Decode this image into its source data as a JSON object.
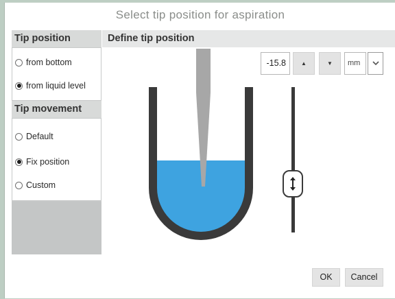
{
  "dialog": {
    "title": "Select tip position for aspiration"
  },
  "tip_position": {
    "heading": "Tip position",
    "options": [
      {
        "label": "from bottom",
        "selected": false
      },
      {
        "label": "from liquid level",
        "selected": true
      }
    ]
  },
  "tip_movement": {
    "heading": "Tip movement",
    "options": [
      {
        "label": "Default",
        "selected": false
      },
      {
        "label": "Fix position",
        "selected": true
      },
      {
        "label": "Custom",
        "selected": false
      }
    ]
  },
  "define": {
    "heading": "Define tip position",
    "value": "-15.8",
    "unit": "mm",
    "up_icon": "triangle-up-icon",
    "down_icon": "triangle-down-icon",
    "dropdown_icon": "chevron-down-icon",
    "slider_handle_icon": "double-arrow-vertical-icon"
  },
  "colors": {
    "liquid": "#3ea3e0",
    "container": "#3a3a3a",
    "tip": "#a7a7a7"
  },
  "buttons": {
    "ok": "OK",
    "cancel": "Cancel"
  }
}
